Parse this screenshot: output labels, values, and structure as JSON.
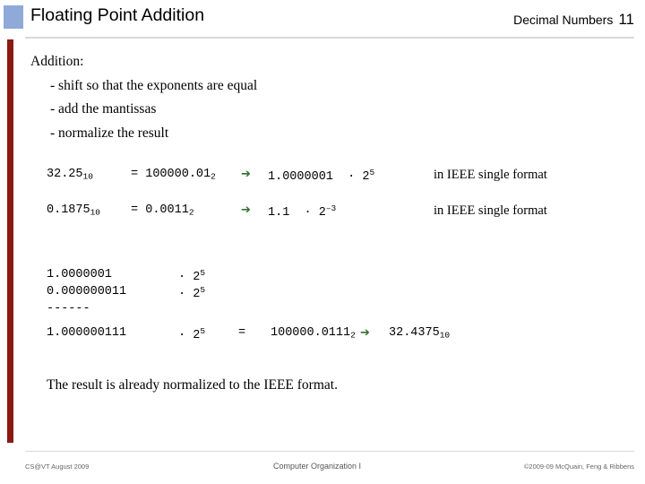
{
  "header": {
    "title": "Floating Point Addition",
    "right_label": "Decimal Numbers",
    "page_number": "11",
    "square_color": "#8fa9d8"
  },
  "body": {
    "lead": "Addition:",
    "bullets": [
      "-  shift so that the exponents are equal",
      "-  add the mantissas",
      "-  normalize the result"
    ],
    "examples": [
      {
        "value": "32.25",
        "value_sub": "10",
        "eq": "=",
        "binary": "100000.01",
        "binary_sub": "2",
        "arrow": "➔",
        "normalized": "1.0000001",
        "dot": "·",
        "base": "2",
        "exp": "5",
        "note": "in IEEE single format"
      },
      {
        "value": "0.1875",
        "value_sub": "10",
        "eq": "=",
        "binary": "0.0011",
        "binary_sub": "2",
        "arrow": "➔",
        "normalized": "1.1",
        "dot": "·",
        "base": "2",
        "exp": "–3",
        "note": "in IEEE single format"
      }
    ],
    "calculation": {
      "line1": {
        "mantissa": "1.0000001",
        "dot": "·",
        "base": "2",
        "exp": "5"
      },
      "line2": {
        "mantissa": "0.000000011",
        "dot": "·",
        "base": "2",
        "exp": "5"
      },
      "rule": "------",
      "line3": {
        "mantissa": "1.000000111",
        "dot": "·",
        "base": "2",
        "exp": "5",
        "eq": "=",
        "binary": "100000.0111",
        "binary_sub": "2",
        "arrow": "➔",
        "decimal": "32.4375",
        "decimal_sub": "10"
      }
    },
    "closing": "The result is already normalized to the IEEE format."
  },
  "footer": {
    "left": "CS@VT August 2009",
    "center": "Computer Organization I",
    "right": "©2009-09  McQuain, Feng & Ribbens"
  }
}
